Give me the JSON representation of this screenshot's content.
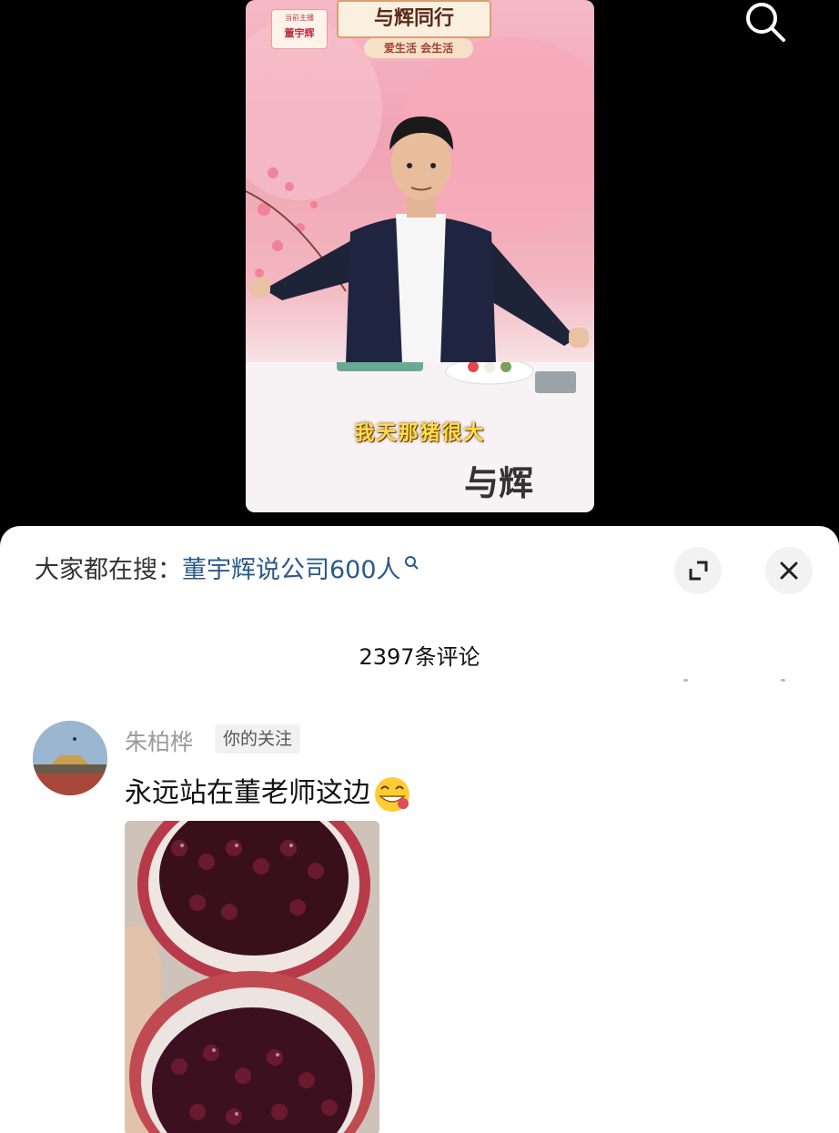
{
  "video": {
    "banner_title": "与辉同行",
    "banner_subtitle": "爱生活 会生活",
    "host_label": "当前主播",
    "host_name": "董宇辉",
    "caption": "我天那猪很大",
    "bottom_logo": "与辉"
  },
  "hot_search": {
    "prefix": "大家都在搜：",
    "query": "董宇辉说公司600人"
  },
  "comments_header": {
    "count_label": "2397条评论"
  },
  "comment": {
    "user_name": "朱柏桦",
    "follow_tag": "你的关注",
    "text": "永远站在董老师这边"
  },
  "icons": {
    "search": "search-icon",
    "expand": "expand-icon",
    "close": "close-icon",
    "emoji": "grinning-emoji-icon"
  },
  "colors": {
    "link": "#2a5a8a",
    "sheet_bg": "#ffffff",
    "video_bg": "#000000"
  }
}
